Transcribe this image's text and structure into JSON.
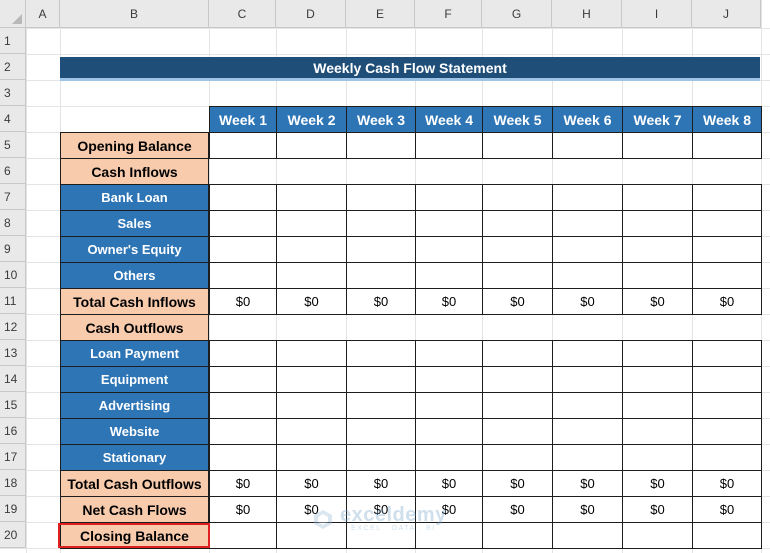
{
  "column_headers": [
    "A",
    "B",
    "C",
    "D",
    "E",
    "F",
    "G",
    "H",
    "I",
    "J"
  ],
  "row_headers": [
    "1",
    "2",
    "3",
    "4",
    "5",
    "6",
    "7",
    "8",
    "9",
    "10",
    "11",
    "12",
    "13",
    "14",
    "15",
    "16",
    "17",
    "18",
    "19",
    "20"
  ],
  "title": "Weekly Cash Flow Statement",
  "weeks": [
    "Week 1",
    "Week 2",
    "Week 3",
    "Week 4",
    "Week 5",
    "Week 6",
    "Week 7",
    "Week 8"
  ],
  "rows": [
    {
      "label": "Opening Balance",
      "style": "peach",
      "values": [
        "",
        "",
        "",
        "",
        "",
        "",
        "",
        ""
      ]
    },
    {
      "label": "Cash Inflows",
      "style": "peach",
      "values": null
    },
    {
      "label": "Bank Loan",
      "style": "blue",
      "values": [
        "",
        "",
        "",
        "",
        "",
        "",
        "",
        ""
      ]
    },
    {
      "label": "Sales",
      "style": "blue",
      "values": [
        "",
        "",
        "",
        "",
        "",
        "",
        "",
        ""
      ]
    },
    {
      "label": "Owner's Equity",
      "style": "blue",
      "values": [
        "",
        "",
        "",
        "",
        "",
        "",
        "",
        ""
      ]
    },
    {
      "label": "Others",
      "style": "blue",
      "values": [
        "",
        "",
        "",
        "",
        "",
        "",
        "",
        ""
      ]
    },
    {
      "label": "Total Cash Inflows",
      "style": "peach",
      "values": [
        "$0",
        "$0",
        "$0",
        "$0",
        "$0",
        "$0",
        "$0",
        "$0"
      ]
    },
    {
      "label": "Cash Outflows",
      "style": "peach",
      "values": null
    },
    {
      "label": "Loan Payment",
      "style": "blue",
      "values": [
        "",
        "",
        "",
        "",
        "",
        "",
        "",
        ""
      ]
    },
    {
      "label": "Equipment",
      "style": "blue",
      "values": [
        "",
        "",
        "",
        "",
        "",
        "",
        "",
        ""
      ]
    },
    {
      "label": "Advertising",
      "style": "blue",
      "values": [
        "",
        "",
        "",
        "",
        "",
        "",
        "",
        ""
      ]
    },
    {
      "label": "Website",
      "style": "blue",
      "values": [
        "",
        "",
        "",
        "",
        "",
        "",
        "",
        ""
      ]
    },
    {
      "label": "Stationary",
      "style": "blue",
      "values": [
        "",
        "",
        "",
        "",
        "",
        "",
        "",
        ""
      ]
    },
    {
      "label": "Total Cash Outflows",
      "style": "peach",
      "values": [
        "$0",
        "$0",
        "$0",
        "$0",
        "$0",
        "$0",
        "$0",
        "$0"
      ]
    },
    {
      "label": "Net Cash Flows",
      "style": "peach",
      "values": [
        "$0",
        "$0",
        "$0",
        "$0",
        "$0",
        "$0",
        "$0",
        "$0"
      ]
    },
    {
      "label": "Closing Balance",
      "style": "peach",
      "values": [
        "",
        "",
        "",
        "",
        "",
        "",
        "",
        ""
      ],
      "highlighted": true
    }
  ],
  "watermark": {
    "main": "exceldemy",
    "sub": "EXCEL · DATA · BI"
  },
  "colors": {
    "title_bar": "#1f4e79",
    "header_blue": "#2e75b6",
    "peach": "#f8cbad",
    "highlight": "#e02020"
  }
}
